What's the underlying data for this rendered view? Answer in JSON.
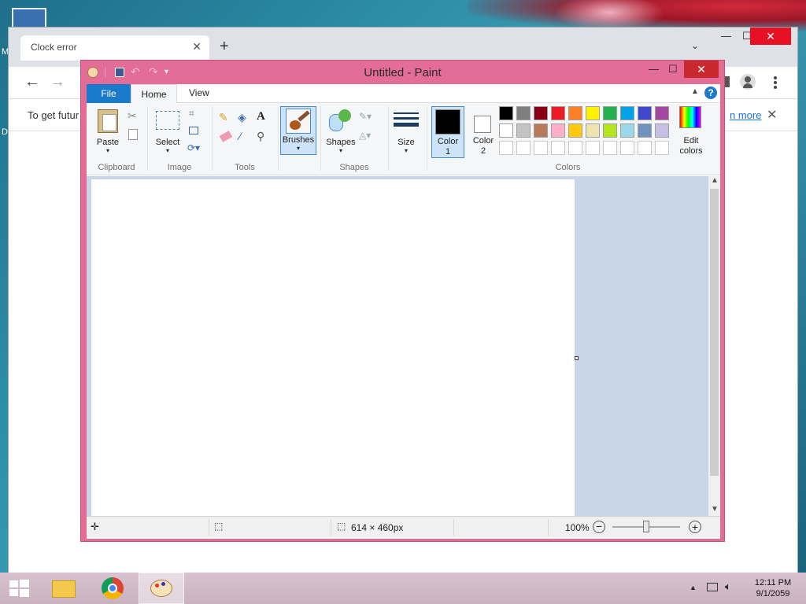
{
  "desktop": {
    "letter_top": "M",
    "letter_bottom": "D"
  },
  "chrome": {
    "tab_title": "Clock error",
    "tab_close": "✕",
    "new_tab": "+",
    "tab_dropdown": "⌄",
    "minimize": "—",
    "maximize": "☐",
    "close": "✕",
    "back": "←",
    "forward": "→",
    "info_text": "To get futur",
    "info_link": "n more",
    "info_close": "✕"
  },
  "paint": {
    "title": "Untitled - Paint",
    "minimize": "—",
    "maximize": "☐",
    "close": "✕",
    "tabs": {
      "file": "File",
      "home": "Home",
      "view": "View"
    },
    "help": "?",
    "groups": {
      "clipboard": "Clipboard",
      "image": "Image",
      "tools": "Tools",
      "shapes": "Shapes",
      "colors": "Colors"
    },
    "buttons": {
      "paste": "Paste",
      "select": "Select",
      "brushes": "Brushes",
      "shapes": "Shapes",
      "size": "Size",
      "color1_line1": "Color",
      "color1_line2": "1",
      "color2_line1": "Color",
      "color2_line2": "2",
      "edit_colors_line1": "Edit",
      "edit_colors_line2": "colors"
    },
    "tool_text_glyph": "A",
    "color1": "#000000",
    "color2": "#ffffff",
    "palette_row1": [
      "#000000",
      "#7f7f7f",
      "#880015",
      "#ed1c24",
      "#ff7f27",
      "#fff200",
      "#22b14c",
      "#00a2e8",
      "#3f48cc",
      "#a349a4"
    ],
    "palette_row2": [
      "#ffffff",
      "#c3c3c3",
      "#b97a57",
      "#ffaec9",
      "#ffc90e",
      "#efe4b0",
      "#b5e61d",
      "#99d9ea",
      "#7092be",
      "#c8bfe7"
    ],
    "status": {
      "dimensions": "614 × 460px",
      "zoom": "100%"
    }
  },
  "taskbar": {
    "time": "12:11 PM",
    "date": "9/1/2059"
  }
}
